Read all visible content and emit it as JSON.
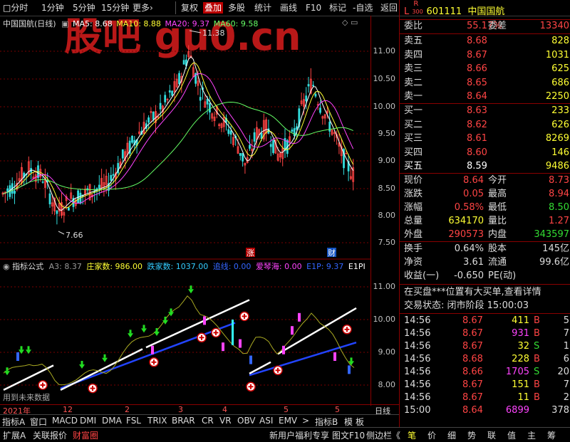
{
  "toolbar": {
    "items": [
      "分时",
      "1分钟",
      "5分钟",
      "15分钟",
      "更多›",
      "复权",
      "叠加",
      "多股",
      "统计",
      "画线",
      "F10",
      "标记",
      "-自选",
      "返回"
    ]
  },
  "main_chart": {
    "title": "中国国航(日线)",
    "ma5": "MA5: 8.68",
    "ma10": "MA10: 8.88",
    "ma20": "MA20: 9.37",
    "ma60": "MA60: 9.58",
    "high_label": "11.38",
    "low_label": "7.66",
    "watermark": "股吧 gu0.cn",
    "axis_ticks": [
      "11.00",
      "10.50",
      "10.00",
      "9.50",
      "9.00",
      "8.50",
      "8.00",
      "7.50"
    ],
    "badge_zhang": "涨",
    "badge_cai": "财"
  },
  "indicator": {
    "name": "指标公式",
    "a3": "A3: 8.37",
    "zhuangjia": "庄家数: 986.00",
    "diejia": "跌家数: 1037.00",
    "zhuixian": "追线: 0.00",
    "aiqinhai": "爱琴海: 0.00",
    "e1p": "E1P: 9.37",
    "e1pp": "E1PI",
    "axis_ticks": [
      "11.00",
      "10.00",
      "9.00",
      "8.00"
    ],
    "future_note": "用到未来数据"
  },
  "time_axis": {
    "labels": [
      "2021年",
      "12",
      "2",
      "3",
      "4",
      "5"
    ],
    "period": "日线"
  },
  "tabs": [
    "指标A",
    "窗口",
    "MACD",
    "DMI",
    "DMA",
    "FSL",
    "TRIX",
    "BRAR",
    "CR",
    "VR",
    "OBV",
    "ASI",
    "EMV",
    ">",
    "指标B",
    "模",
    "板"
  ],
  "bottom": {
    "left": [
      "扩展A",
      "关联报价",
      "财富圈"
    ],
    "news": "新用户福利专享",
    "f10": "图文F10",
    "side": "侧边栏《",
    "right_icons": [
      "笔",
      "价",
      "细",
      "势",
      "联",
      "值",
      "主",
      "筹"
    ]
  },
  "stock": {
    "code": "601111",
    "name": "中国国航",
    "l_label": "L",
    "r_label": "R",
    "r_sub": "300",
    "weibi_label": "委比",
    "weibi_val": "55.17%",
    "weicha_label": "委差",
    "weicha_val": "13340",
    "asks": [
      {
        "label": "卖五",
        "price": "8.68",
        "vol": "828"
      },
      {
        "label": "卖四",
        "price": "8.67",
        "vol": "1031"
      },
      {
        "label": "卖三",
        "price": "8.66",
        "vol": "625"
      },
      {
        "label": "卖二",
        "price": "8.65",
        "vol": "686"
      },
      {
        "label": "卖一",
        "price": "8.64",
        "vol": "2250"
      }
    ],
    "bids": [
      {
        "label": "买一",
        "price": "8.63",
        "vol": "233"
      },
      {
        "label": "买二",
        "price": "8.62",
        "vol": "626"
      },
      {
        "label": "买三",
        "price": "8.61",
        "vol": "8269"
      },
      {
        "label": "买四",
        "price": "8.60",
        "vol": "146"
      },
      {
        "label": "买五",
        "price": "8.59",
        "vol": "9486"
      }
    ],
    "stats": [
      {
        "l1": "现价",
        "v1": "8.64",
        "l2": "今开",
        "v2": "8.73"
      },
      {
        "l1": "涨跌",
        "v1": "0.05",
        "l2": "最高",
        "v2": "8.94"
      },
      {
        "l1": "涨幅",
        "v1": "0.58%",
        "l2": "最低",
        "v2": "8.50"
      },
      {
        "l1": "总量",
        "v1": "634170",
        "l2": "量比",
        "v2": "1.27"
      },
      {
        "l1": "外盘",
        "v1": "290573",
        "l2": "内盘",
        "v2": "343597"
      }
    ],
    "stats2": [
      {
        "l1": "换手",
        "v1": "0.64%",
        "l2": "股本",
        "v2": "145亿"
      },
      {
        "l1": "净资",
        "v1": "3.61",
        "l2": "流通",
        "v2": "99.6亿"
      },
      {
        "l1": "收益(一)",
        "v1": "-0.650",
        "l2": "PE(动)",
        "v2": ""
      }
    ],
    "notice": "在买盘***位置有大买单,查看详情",
    "status": "交易状态: 闭市阶段 15:00:03",
    "ticks": [
      {
        "t": "14:56",
        "p": "8.67",
        "v": "411",
        "s": "B"
      },
      {
        "t": "14:56",
        "p": "8.67",
        "v": "931",
        "s": "B"
      },
      {
        "t": "14:56",
        "p": "8.67",
        "v": "32",
        "s": "S"
      },
      {
        "t": "14:56",
        "p": "8.68",
        "v": "228",
        "s": "B"
      },
      {
        "t": "14:56",
        "p": "8.66",
        "v": "1705",
        "s": "S"
      },
      {
        "t": "14:56",
        "p": "8.67",
        "v": "151",
        "s": "B"
      },
      {
        "t": "14:56",
        "p": "8.67",
        "v": "11",
        "s": "B"
      },
      {
        "t": "15:00",
        "p": "8.64",
        "v": "6899",
        "s": ""
      }
    ],
    "tick_extra": [
      "5",
      "7",
      "1",
      "6",
      "20",
      "7",
      "2",
      "378"
    ]
  },
  "colors": {
    "up": "#ff4444",
    "down": "#33dd33",
    "border": "#8a0000"
  }
}
